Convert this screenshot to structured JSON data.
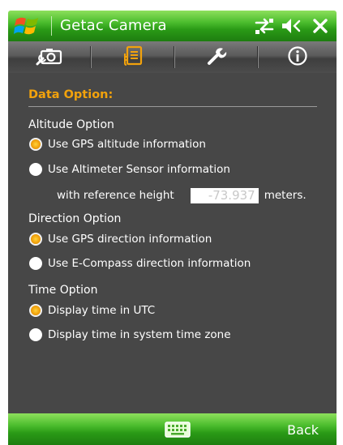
{
  "titlebar": {
    "title": "Getac Camera",
    "icons": [
      "windows-start-icon",
      "network-connectivity-icon",
      "speaker-muted-icon",
      "close-icon"
    ]
  },
  "tabs": [
    {
      "name": "camera-settings",
      "icon": "camera-wrench-icon"
    },
    {
      "name": "data-option",
      "icon": "document-list-icon",
      "active": true
    },
    {
      "name": "tools",
      "icon": "wrench-icon"
    },
    {
      "name": "about",
      "icon": "info-icon"
    }
  ],
  "content": {
    "section_title": "Data Option:",
    "altitude": {
      "label": "Altitude Option",
      "gps": "Use GPS altitude information",
      "sensor": "Use Altimeter Sensor information",
      "ref_label": "with reference height",
      "ref_value": "-73.937",
      "ref_unit": "meters.",
      "selected": "gps"
    },
    "direction": {
      "label": "Direction Option",
      "gps": "Use GPS direction information",
      "compass": "Use E-Compass direction information",
      "selected": "gps"
    },
    "time": {
      "label": "Time Option",
      "utc": "Display time in UTC",
      "system": "Display time in system time zone",
      "selected": "utc"
    }
  },
  "bottombar": {
    "keyboard_icon": "keyboard-icon",
    "back_label": "Back"
  },
  "colors": {
    "accent": "#f2a20c",
    "titlebar_green": "#2a9a16",
    "content_bg": "#474747"
  }
}
